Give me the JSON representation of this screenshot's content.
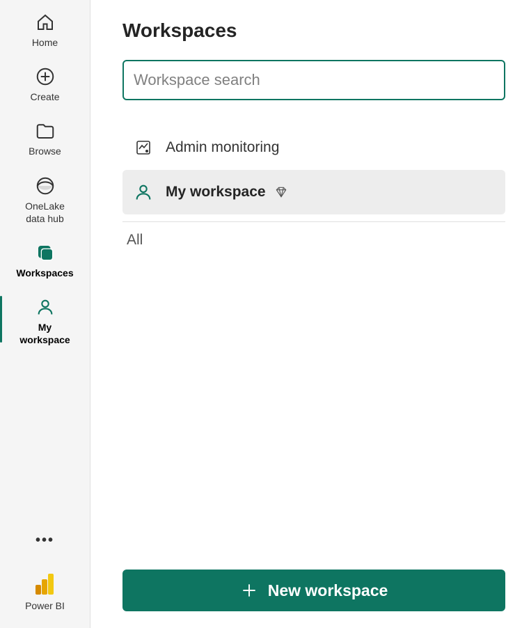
{
  "sidebar": {
    "items": [
      {
        "label": "Home"
      },
      {
        "label": "Create"
      },
      {
        "label": "Browse"
      },
      {
        "label": "OneLake\ndata hub"
      },
      {
        "label": "Workspaces"
      },
      {
        "label": "My\nworkspace"
      }
    ],
    "brand_label": "Power BI"
  },
  "main": {
    "title": "Workspaces",
    "search_placeholder": "Workspace search",
    "workspace_items": [
      {
        "label": "Admin monitoring"
      },
      {
        "label": "My workspace"
      }
    ],
    "section_label": "All",
    "new_workspace_label": "New workspace"
  },
  "colors": {
    "accent": "#0e7561"
  }
}
